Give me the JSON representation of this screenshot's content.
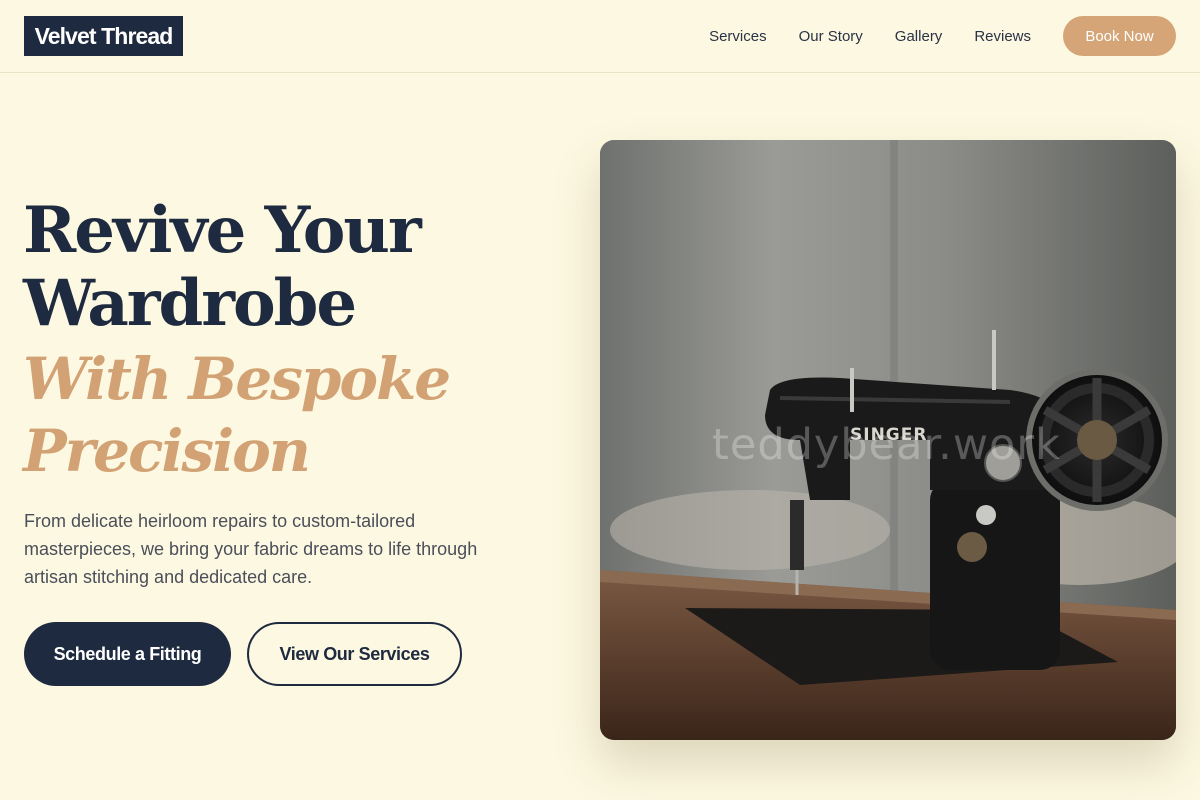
{
  "brand": {
    "name": "Velvet Thread"
  },
  "nav": {
    "links": [
      "Services",
      "Our Story",
      "Gallery",
      "Reviews"
    ],
    "cta": "Book Now"
  },
  "hero": {
    "title_lines": [
      "Revive Your",
      "Wardrobe"
    ],
    "accent_lines": [
      "With Bespoke",
      "Precision"
    ],
    "description_lines": [
      "From delicate heirloom repairs to custom-tailored",
      "masterpieces, we bring your fabric dreams to life through",
      "artisan stitching and dedicated care."
    ],
    "primary_cta": "Schedule a Fitting",
    "secondary_cta": "View Our Services",
    "image": {
      "subject": "vintage sewing machine on wooden table",
      "machine_label": "SINGER",
      "watermark": "teddybear.work"
    }
  },
  "colors": {
    "background": "#fdf8e1",
    "navy": "#1e2a3f",
    "accent": "#d2a274",
    "book_button": "#d5a577"
  }
}
